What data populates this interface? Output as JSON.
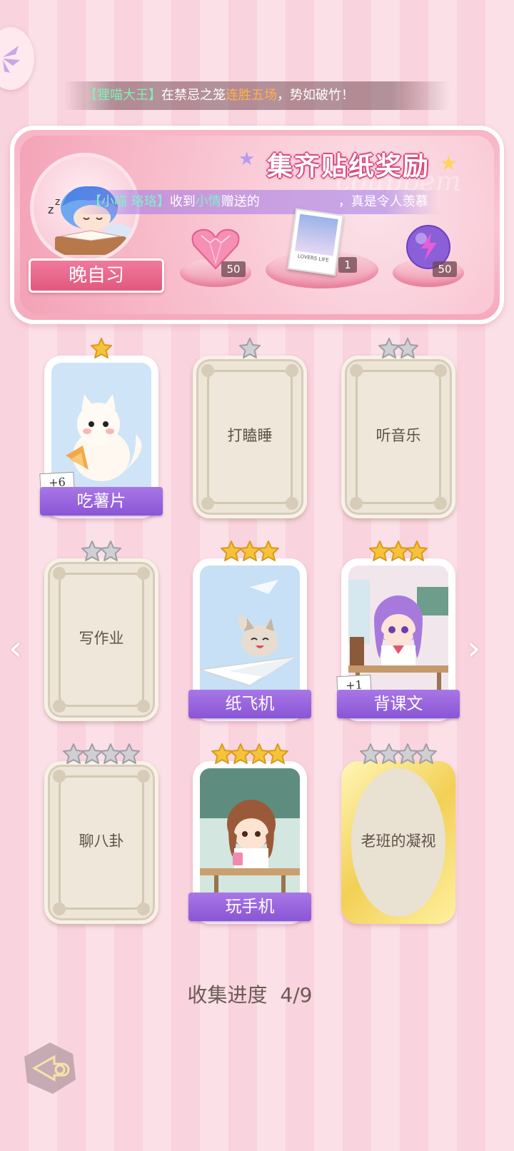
{
  "marquee": {
    "user": "【狸喵大王】",
    "mid": "在禁忌之笼",
    "highlight": "连胜五场",
    "tail": "，势如破竹！"
  },
  "banner": {
    "title": "集齐贴纸奖励",
    "ghost_text": "couppem",
    "broadcast": {
      "user": "【小喵 珞珞】",
      "text1": "收到",
      "recipient": "小情",
      "text2": "赠送的",
      "text3": "，真是令人羡慕"
    },
    "label": "晚自习",
    "rewards": [
      {
        "name": "pink-heart-gem",
        "count": "50"
      },
      {
        "name": "ticket-card",
        "count": "1",
        "card_text": "LOVERS LIFE"
      },
      {
        "name": "purple-lightning-orb",
        "count": "50"
      }
    ]
  },
  "cards": [
    {
      "label": "吃薯片",
      "stars": 1,
      "star_color": "gold",
      "unlocked": true,
      "badge": "+6"
    },
    {
      "label": "打瞌睡",
      "stars": 1,
      "star_color": "silver",
      "unlocked": false
    },
    {
      "label": "听音乐",
      "stars": 2,
      "star_color": "silver",
      "unlocked": false
    },
    {
      "label": "写作业",
      "stars": 2,
      "star_color": "silver",
      "unlocked": false
    },
    {
      "label": "纸飞机",
      "stars": 3,
      "star_color": "gold",
      "unlocked": true
    },
    {
      "label": "背课文",
      "stars": 3,
      "star_color": "gold",
      "unlocked": true,
      "badge": "+1"
    },
    {
      "label": "聊八卦",
      "stars": 4,
      "star_color": "silver",
      "unlocked": false
    },
    {
      "label": "玩手机",
      "stars": 4,
      "star_color": "gold",
      "unlocked": true
    },
    {
      "label": "老班的凝视",
      "stars": 4,
      "star_color": "silver",
      "unlocked": false,
      "special": "gold-frame"
    }
  ],
  "progress": {
    "label": "收集进度",
    "value": "4/9",
    "collected": 4,
    "total": 9
  },
  "colors": {
    "accent_purple": "#9a63dd",
    "pink_bg": "#f9d3dd",
    "gold_star": "#f5c33b",
    "silver_star": "#cfcfd4"
  },
  "nav": {
    "prev_icon": "chevron-left-icon",
    "next_icon": "chevron-right-icon",
    "back_icon": "back-arrow-icon",
    "menu_icon": "fan-menu-icon"
  }
}
